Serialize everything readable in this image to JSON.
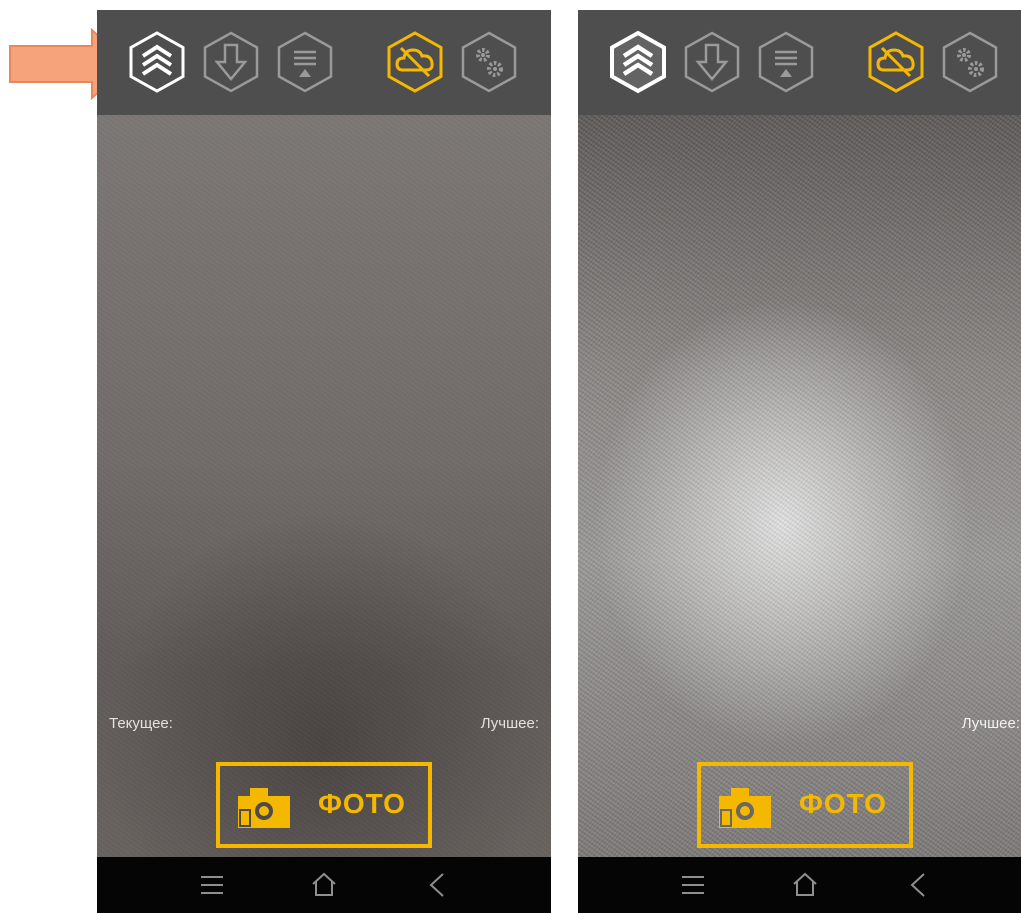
{
  "colors": {
    "accent": "#f5b800",
    "toolbar_bg": "#4e4e4e",
    "icon_inactive": "#9a9a9a",
    "icon_active": "#ffffff",
    "navbar_bg": "#050505",
    "annotation_arrow": "#f6a37b"
  },
  "screens": [
    {
      "toolbar": {
        "icons": [
          "layers-icon",
          "download-icon",
          "menu-upload-icon",
          "cloud-off-icon",
          "settings-gears-icon"
        ]
      },
      "labels": {
        "current": "Текущее:",
        "best": "Лучшее:"
      },
      "photo_button": {
        "label": "ФОТО",
        "icon": "camera-icon"
      },
      "navbar": {
        "icons": [
          "menu-icon",
          "home-icon",
          "back-icon"
        ]
      }
    },
    {
      "toolbar": {
        "icons": [
          "layers-icon",
          "download-icon",
          "menu-upload-icon",
          "cloud-off-icon",
          "settings-gears-icon"
        ]
      },
      "labels": {
        "current": "",
        "best": "Лучшее:"
      },
      "photo_button": {
        "label": "ФОТО",
        "icon": "camera-icon"
      },
      "navbar": {
        "icons": [
          "menu-icon",
          "home-icon",
          "back-icon"
        ]
      }
    }
  ],
  "annotation": {
    "icon": "arrow-right-icon"
  }
}
